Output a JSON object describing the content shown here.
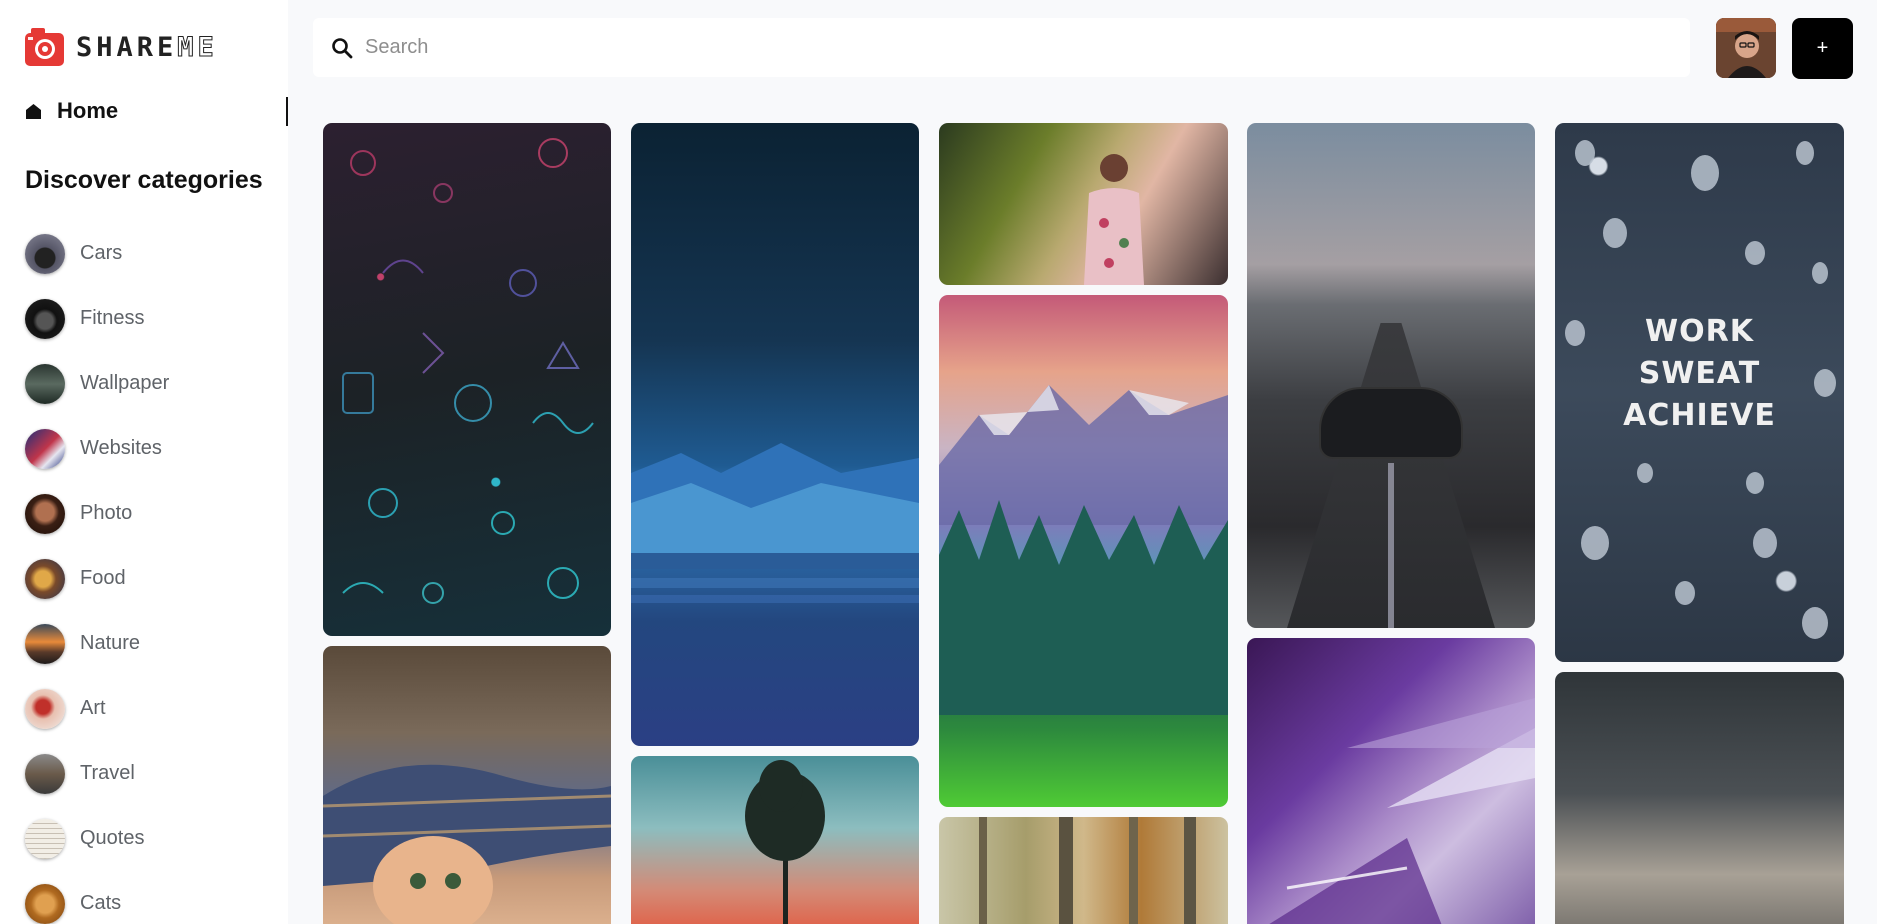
{
  "app": {
    "logo_text": "SHAREME",
    "logo_text_solid": "SHARE",
    "logo_text_outline": "ME",
    "accent_color": "#e53935"
  },
  "sidebar": {
    "home_label": "Home",
    "discover_title": "Discover categories",
    "categories": [
      {
        "label": "Cars"
      },
      {
        "label": "Fitness"
      },
      {
        "label": "Wallpaper"
      },
      {
        "label": "Websites"
      },
      {
        "label": "Photo"
      },
      {
        "label": "Food"
      },
      {
        "label": "Nature"
      },
      {
        "label": "Art"
      },
      {
        "label": "Travel"
      },
      {
        "label": "Quotes"
      },
      {
        "label": "Cats"
      }
    ]
  },
  "header": {
    "search_placeholder": "Search",
    "search_value": "",
    "add_button_label": "+"
  },
  "pins": [
    {
      "subject": "doodle pattern wallpaper"
    },
    {
      "subject": "night mountain moon landscape"
    },
    {
      "subject": "woman posing by flowers"
    },
    {
      "subject": "mountain forest landscape"
    },
    {
      "subject": "autumn forest painting"
    },
    {
      "subject": "sports car on highway"
    },
    {
      "subject": "purple abstract explosion"
    },
    {
      "subject": "water drops quote",
      "text_lines": [
        "WORK",
        "SWEAT",
        "ACHIEVE"
      ]
    },
    {
      "subject": "cloudy sky"
    },
    {
      "subject": "kitten under blanket"
    },
    {
      "subject": "tree at sunset"
    }
  ]
}
